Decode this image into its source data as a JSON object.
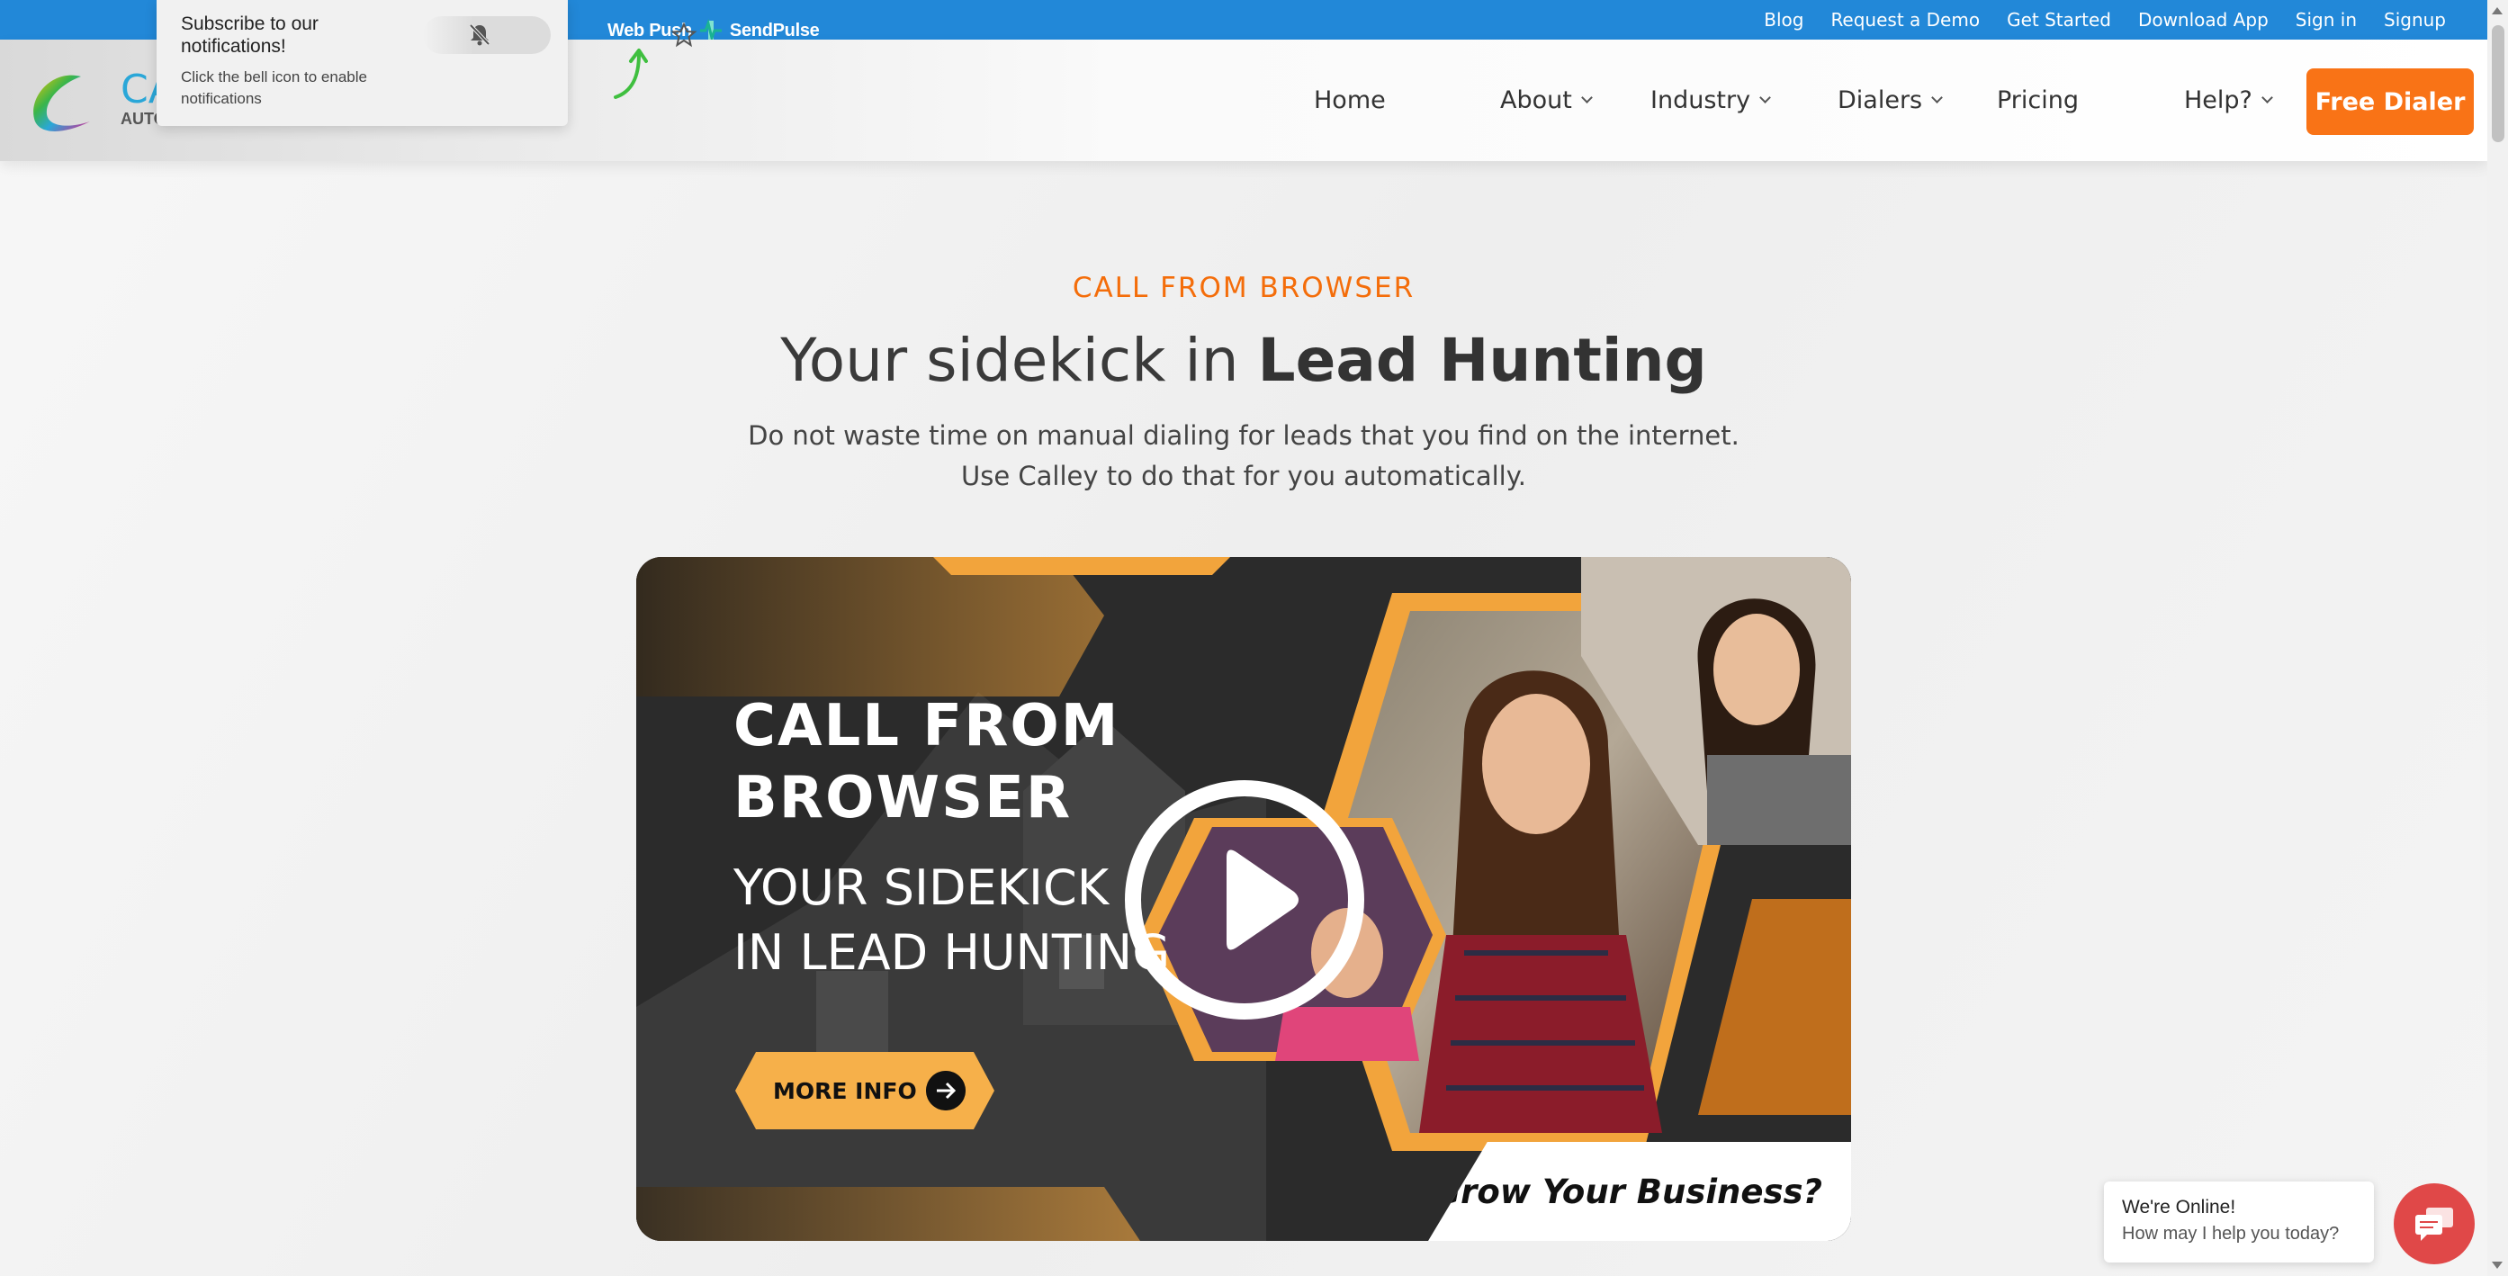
{
  "topbar": {
    "sendpulse": {
      "web_push": "Web Push",
      "brand": "SendPulse"
    },
    "links": [
      "Blog",
      "Request a Demo",
      "Get Started",
      "Download App",
      "Sign in",
      "Signup"
    ]
  },
  "notification": {
    "title": "Subscribe to our notifications!",
    "description": "Click the bell icon to enable notifications"
  },
  "header": {
    "logo_text": "CA",
    "logo_sub": "AUTO",
    "nav": {
      "home": "Home",
      "about": "About",
      "industry": "Industry",
      "dialers": "Dialers",
      "pricing": "Pricing",
      "help": "Help?"
    },
    "cta": "Free Dialer"
  },
  "hero": {
    "eyebrow": "CALL FROM BROWSER",
    "headline_regular": "Your sidekick in ",
    "headline_bold": "Lead Hunting",
    "sub_line1": "Do not waste time on manual dialing for leads that you find on the internet.",
    "sub_line2": "Use Calley to do that for you automatically."
  },
  "video": {
    "title_line1": "CALL FROM",
    "title_line2": "BROWSER",
    "sub_line1": "YOUR SIDEKICK",
    "sub_line2": "IN LEAD HUNTING",
    "more_info": "MORE INFO",
    "grow": "Grow Your Business?"
  },
  "chat": {
    "title": "We're Online!",
    "message": "How may I help you today?"
  },
  "colors": {
    "topbar": "#2288d8",
    "accent_orange": "#f97316",
    "eyebrow_orange": "#f46d0a",
    "video_gold": "#f6b04a",
    "chat_red": "#e04848"
  }
}
